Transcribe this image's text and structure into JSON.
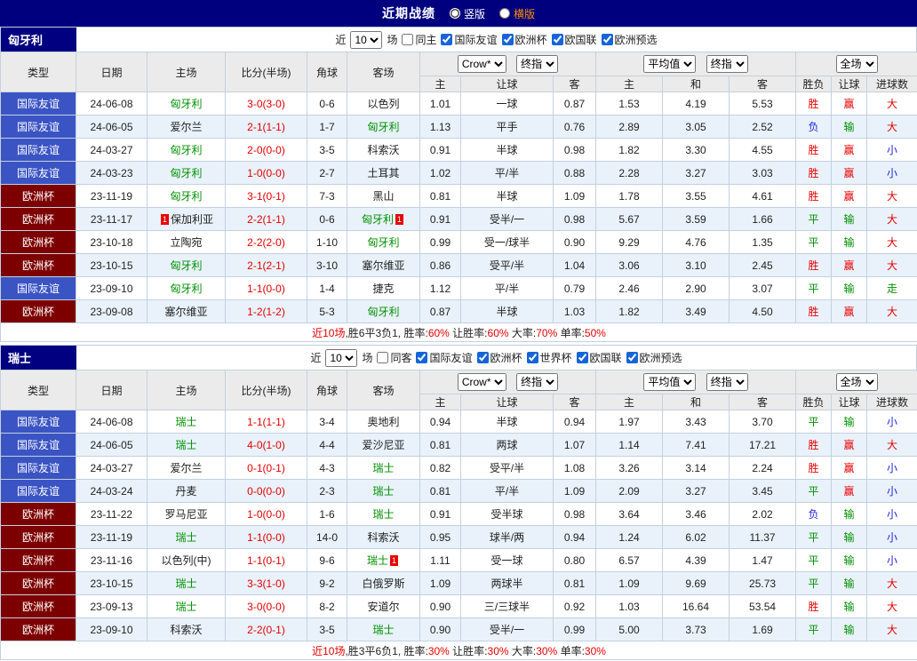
{
  "top_bar": {
    "title": "近期战绩",
    "vertical_label": "竖版",
    "horizontal_label": "横版"
  },
  "colors": {
    "navy": "#000080",
    "type_blue": "#3B54C4",
    "type_maroon": "#7D0000",
    "win_red": "#E60000",
    "draw_green": "#009000",
    "lose_blue": "#2222E0",
    "team_green": "#009000",
    "row_alt": "#E9F2FB"
  },
  "sections": [
    {
      "team": "匈牙利",
      "filter": {
        "near_label": "近",
        "count": "10",
        "games_label": "场",
        "same_label": "同主",
        "same_checked": false,
        "leagues": [
          "国际友谊",
          "欧洲杯",
          "欧国联",
          "欧洲预选"
        ]
      },
      "header": {
        "type": "类型",
        "date": "日期",
        "home": "主场",
        "score": "比分(半场)",
        "corner": "角球",
        "away": "客场",
        "odds_company": "Crow*",
        "odds_final": "终指",
        "eu_company": "平均值",
        "eu_final": "终指",
        "scope": "全场",
        "sub": [
          "主",
          "让球",
          "客",
          "主",
          "和",
          "客",
          "胜负",
          "让球",
          "进球数"
        ]
      },
      "rows": [
        {
          "type": "国际友谊",
          "date": "24-06-08",
          "home": "匈牙利",
          "homeHl": true,
          "score": "3-0(3-0)",
          "corner": "0-6",
          "away": "以色列",
          "awayHl": false,
          "ahHome": "1.01",
          "ahLine": "一球",
          "ahAway": "0.87",
          "euHome": "1.53",
          "euDraw": "4.19",
          "euAway": "5.53",
          "result": "胜",
          "letResult": "赢",
          "goals": "大"
        },
        {
          "type": "国际友谊",
          "date": "24-06-05",
          "home": "爱尔兰",
          "homeHl": false,
          "score": "2-1(1-1)",
          "corner": "1-7",
          "away": "匈牙利",
          "awayHl": true,
          "ahHome": "1.13",
          "ahLine": "平手",
          "ahAway": "0.76",
          "euHome": "2.89",
          "euDraw": "3.05",
          "euAway": "2.52",
          "result": "负",
          "letResult": "输",
          "goals": "大"
        },
        {
          "type": "国际友谊",
          "date": "24-03-27",
          "home": "匈牙利",
          "homeHl": true,
          "score": "2-0(0-0)",
          "corner": "3-5",
          "away": "科索沃",
          "awayHl": false,
          "ahHome": "0.91",
          "ahLine": "半球",
          "ahAway": "0.98",
          "euHome": "1.82",
          "euDraw": "3.30",
          "euAway": "4.55",
          "result": "胜",
          "letResult": "赢",
          "goals": "小"
        },
        {
          "type": "国际友谊",
          "date": "24-03-23",
          "home": "匈牙利",
          "homeHl": true,
          "score": "1-0(0-0)",
          "corner": "2-7",
          "away": "土耳其",
          "awayHl": false,
          "ahHome": "1.02",
          "ahLine": "平/半",
          "ahAway": "0.88",
          "euHome": "2.28",
          "euDraw": "3.27",
          "euAway": "3.03",
          "result": "胜",
          "letResult": "赢",
          "goals": "小"
        },
        {
          "type": "欧洲杯",
          "date": "23-11-19",
          "home": "匈牙利",
          "homeHl": true,
          "score": "3-1(0-1)",
          "corner": "7-3",
          "away": "黑山",
          "awayHl": false,
          "ahHome": "0.81",
          "ahLine": "半球",
          "ahAway": "1.09",
          "euHome": "1.78",
          "euDraw": "3.55",
          "euAway": "4.61",
          "result": "胜",
          "letResult": "赢",
          "goals": "大"
        },
        {
          "type": "欧洲杯",
          "date": "23-11-17",
          "home": "保加利亚",
          "homeHl": false,
          "homeBadge": "1",
          "score": "2-2(1-1)",
          "corner": "0-6",
          "away": "匈牙利",
          "awayHl": true,
          "awayBadge": "1",
          "ahHome": "0.91",
          "ahLine": "受半/一",
          "ahAway": "0.98",
          "euHome": "5.67",
          "euDraw": "3.59",
          "euAway": "1.66",
          "result": "平",
          "letResult": "输",
          "goals": "大"
        },
        {
          "type": "欧洲杯",
          "date": "23-10-18",
          "home": "立陶宛",
          "homeHl": false,
          "score": "2-2(2-0)",
          "corner": "1-10",
          "away": "匈牙利",
          "awayHl": true,
          "ahHome": "0.99",
          "ahLine": "受一/球半",
          "ahAway": "0.90",
          "euHome": "9.29",
          "euDraw": "4.76",
          "euAway": "1.35",
          "result": "平",
          "letResult": "输",
          "goals": "大"
        },
        {
          "type": "欧洲杯",
          "date": "23-10-15",
          "home": "匈牙利",
          "homeHl": true,
          "score": "2-1(2-1)",
          "corner": "3-10",
          "away": "塞尔维亚",
          "awayHl": false,
          "ahHome": "0.86",
          "ahLine": "受平/半",
          "ahAway": "1.04",
          "euHome": "3.06",
          "euDraw": "3.10",
          "euAway": "2.45",
          "result": "胜",
          "letResult": "赢",
          "goals": "大"
        },
        {
          "type": "国际友谊",
          "date": "23-09-10",
          "home": "匈牙利",
          "homeHl": true,
          "score": "1-1(0-0)",
          "corner": "1-4",
          "away": "捷克",
          "awayHl": false,
          "ahHome": "1.12",
          "ahLine": "平/半",
          "ahAway": "0.79",
          "euHome": "2.46",
          "euDraw": "2.90",
          "euAway": "3.07",
          "result": "平",
          "letResult": "输",
          "goals": "走"
        },
        {
          "type": "欧洲杯",
          "date": "23-09-08",
          "home": "塞尔维亚",
          "homeHl": false,
          "score": "1-2(1-2)",
          "corner": "5-3",
          "away": "匈牙利",
          "awayHl": true,
          "ahHome": "0.87",
          "ahLine": "半球",
          "ahAway": "1.03",
          "euHome": "1.82",
          "euDraw": "3.49",
          "euAway": "4.50",
          "result": "胜",
          "letResult": "赢",
          "goals": "大"
        }
      ],
      "summary_segments": [
        {
          "text": "近10场",
          "color": "red"
        },
        {
          "text": ",胜6平3负1, 胜率:",
          "color": "black"
        },
        {
          "text": "60%",
          "color": "red"
        },
        {
          "text": " 让胜率:",
          "color": "black"
        },
        {
          "text": "60%",
          "color": "red"
        },
        {
          "text": " 大率:",
          "color": "black"
        },
        {
          "text": "70%",
          "color": "red"
        },
        {
          "text": " 单率:",
          "color": "black"
        },
        {
          "text": "50%",
          "color": "red"
        }
      ]
    },
    {
      "team": "瑞士",
      "filter": {
        "near_label": "近",
        "count": "10",
        "games_label": "场",
        "same_label": "同客",
        "same_checked": false,
        "leagues": [
          "国际友谊",
          "欧洲杯",
          "世界杯",
          "欧国联",
          "欧洲预选"
        ]
      },
      "header": {
        "type": "类型",
        "date": "日期",
        "home": "主场",
        "score": "比分(半场)",
        "corner": "角球",
        "away": "客场",
        "odds_company": "Crow*",
        "odds_final": "终指",
        "eu_company": "平均值",
        "eu_final": "终指",
        "scope": "全场",
        "sub": [
          "主",
          "让球",
          "客",
          "主",
          "和",
          "客",
          "胜负",
          "让球",
          "进球数"
        ]
      },
      "rows": [
        {
          "type": "国际友谊",
          "date": "24-06-08",
          "home": "瑞士",
          "homeHl": true,
          "score": "1-1(1-1)",
          "corner": "3-4",
          "away": "奥地利",
          "awayHl": false,
          "ahHome": "0.94",
          "ahLine": "半球",
          "ahAway": "0.94",
          "euHome": "1.97",
          "euDraw": "3.43",
          "euAway": "3.70",
          "result": "平",
          "letResult": "输",
          "goals": "小"
        },
        {
          "type": "国际友谊",
          "date": "24-06-05",
          "home": "瑞士",
          "homeHl": true,
          "score": "4-0(1-0)",
          "corner": "4-4",
          "away": "爱沙尼亚",
          "awayHl": false,
          "ahHome": "0.81",
          "ahLine": "两球",
          "ahAway": "1.07",
          "euHome": "1.14",
          "euDraw": "7.41",
          "euAway": "17.21",
          "result": "胜",
          "letResult": "赢",
          "goals": "大"
        },
        {
          "type": "国际友谊",
          "date": "24-03-27",
          "home": "爱尔兰",
          "homeHl": false,
          "score": "0-1(0-1)",
          "corner": "4-3",
          "away": "瑞士",
          "awayHl": true,
          "ahHome": "0.82",
          "ahLine": "受平/半",
          "ahAway": "1.08",
          "euHome": "3.26",
          "euDraw": "3.14",
          "euAway": "2.24",
          "result": "胜",
          "letResult": "赢",
          "goals": "小"
        },
        {
          "type": "国际友谊",
          "date": "24-03-24",
          "home": "丹麦",
          "homeHl": false,
          "score": "0-0(0-0)",
          "corner": "2-3",
          "away": "瑞士",
          "awayHl": true,
          "ahHome": "0.81",
          "ahLine": "平/半",
          "ahAway": "1.09",
          "euHome": "2.09",
          "euDraw": "3.27",
          "euAway": "3.45",
          "result": "平",
          "letResult": "赢",
          "goals": "小"
        },
        {
          "type": "欧洲杯",
          "date": "23-11-22",
          "home": "罗马尼亚",
          "homeHl": false,
          "score": "1-0(0-0)",
          "corner": "1-6",
          "away": "瑞士",
          "awayHl": true,
          "ahHome": "0.91",
          "ahLine": "受半球",
          "ahAway": "0.98",
          "euHome": "3.64",
          "euDraw": "3.46",
          "euAway": "2.02",
          "result": "负",
          "letResult": "输",
          "goals": "小"
        },
        {
          "type": "欧洲杯",
          "date": "23-11-19",
          "home": "瑞士",
          "homeHl": true,
          "score": "1-1(0-0)",
          "corner": "14-0",
          "away": "科索沃",
          "awayHl": false,
          "ahHome": "0.95",
          "ahLine": "球半/两",
          "ahAway": "0.94",
          "euHome": "1.24",
          "euDraw": "6.02",
          "euAway": "11.37",
          "result": "平",
          "letResult": "输",
          "goals": "小"
        },
        {
          "type": "欧洲杯",
          "date": "23-11-16",
          "home": "以色列(中)",
          "homeHl": false,
          "score": "1-1(0-1)",
          "corner": "9-6",
          "away": "瑞士",
          "awayHl": true,
          "awayBadge": "1",
          "ahHome": "1.11",
          "ahLine": "受一球",
          "ahAway": "0.80",
          "euHome": "6.57",
          "euDraw": "4.39",
          "euAway": "1.47",
          "result": "平",
          "letResult": "输",
          "goals": "小"
        },
        {
          "type": "欧洲杯",
          "date": "23-10-15",
          "home": "瑞士",
          "homeHl": true,
          "score": "3-3(1-0)",
          "corner": "9-2",
          "away": "白俄罗斯",
          "awayHl": false,
          "ahHome": "1.09",
          "ahLine": "两球半",
          "ahAway": "0.81",
          "euHome": "1.09",
          "euDraw": "9.69",
          "euAway": "25.73",
          "result": "平",
          "letResult": "输",
          "goals": "大"
        },
        {
          "type": "欧洲杯",
          "date": "23-09-13",
          "home": "瑞士",
          "homeHl": true,
          "score": "3-0(0-0)",
          "corner": "8-2",
          "away": "安道尔",
          "awayHl": false,
          "ahHome": "0.90",
          "ahLine": "三/三球半",
          "ahAway": "0.92",
          "euHome": "1.03",
          "euDraw": "16.64",
          "euAway": "53.54",
          "result": "胜",
          "letResult": "输",
          "goals": "大"
        },
        {
          "type": "欧洲杯",
          "date": "23-09-10",
          "home": "科索沃",
          "homeHl": false,
          "score": "2-2(0-1)",
          "corner": "3-5",
          "away": "瑞士",
          "awayHl": true,
          "ahHome": "0.90",
          "ahLine": "受半/一",
          "ahAway": "0.99",
          "euHome": "5.00",
          "euDraw": "3.73",
          "euAway": "1.69",
          "result": "平",
          "letResult": "输",
          "goals": "大"
        }
      ],
      "summary_segments": [
        {
          "text": "近10场",
          "color": "red"
        },
        {
          "text": ",胜3平6负1, 胜率:",
          "color": "black"
        },
        {
          "text": "30%",
          "color": "red"
        },
        {
          "text": " 让胜率:",
          "color": "black"
        },
        {
          "text": "30%",
          "color": "red"
        },
        {
          "text": " 大率:",
          "color": "black"
        },
        {
          "text": "30%",
          "color": "red"
        },
        {
          "text": " 单率:",
          "color": "black"
        },
        {
          "text": "30%",
          "color": "red"
        }
      ]
    }
  ]
}
